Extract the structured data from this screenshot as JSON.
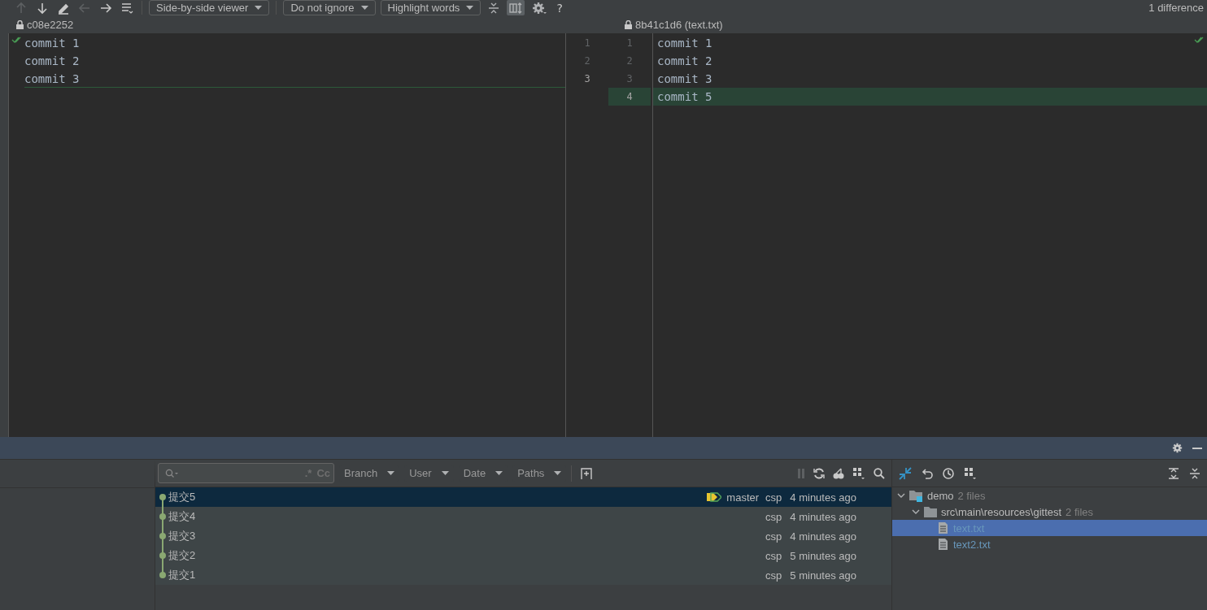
{
  "toolbar": {
    "nav_buttons": [
      {
        "kind": "up",
        "disabled": true
      },
      {
        "kind": "down",
        "disabled": false
      },
      {
        "kind": "edit",
        "disabled": false
      },
      {
        "kind": "left",
        "disabled": true
      },
      {
        "kind": "right",
        "disabled": false
      },
      {
        "kind": "list",
        "disabled": false
      }
    ],
    "dropdowns": [
      "Side-by-side viewer",
      "Do not ignore",
      "Highlight words"
    ],
    "tools": [
      {
        "kind": "collapse",
        "selected": false
      },
      {
        "kind": "sync",
        "selected": true
      },
      {
        "kind": "gear",
        "selected": false
      },
      {
        "kind": "help",
        "selected": false
      }
    ],
    "help": "?",
    "difference_count": "1 difference"
  },
  "left_pane": {
    "title": "c08e2252",
    "lines": [
      "commit 1",
      "commit 2",
      "commit 3"
    ]
  },
  "right_pane": {
    "title": "8b41c1d6 (text.txt)",
    "lines": [
      {
        "left_number": "1",
        "right_number": "1",
        "text": "commit 1",
        "kind": "same"
      },
      {
        "left_number": "2",
        "right_number": "2",
        "text": "commit 2",
        "kind": "same"
      },
      {
        "left_number": "3",
        "right_number": "3",
        "text": "commit 3",
        "kind": "same"
      },
      {
        "right_number": "4",
        "text": "commit 5",
        "kind": "added"
      }
    ]
  },
  "log": {
    "search": {
      "regex": ".*",
      "case": "Cc"
    },
    "filters": [
      "Branch",
      "User",
      "Date",
      "Paths"
    ],
    "commits": [
      {
        "subject": "提交5",
        "tag": "master",
        "author": "csp",
        "date": "4 minutes ago",
        "selected": true
      },
      {
        "subject": "提交4",
        "author": "csp",
        "date": "4 minutes ago",
        "selected": false
      },
      {
        "subject": "提交3",
        "author": "csp",
        "date": "4 minutes ago",
        "selected": false
      },
      {
        "subject": "提交2",
        "author": "csp",
        "date": "5 minutes ago",
        "selected": false
      },
      {
        "subject": "提交1",
        "author": "csp",
        "date": "5 minutes ago",
        "selected": false
      }
    ]
  },
  "changes": {
    "tree": [
      {
        "kind": "module",
        "name": "demo",
        "count": "2 files",
        "expanded": true,
        "children": [
          {
            "kind": "folder",
            "name": "src\\main\\resources\\gittest",
            "count": "2 files",
            "expanded": true,
            "children": [
              {
                "kind": "file",
                "name": "text.txt",
                "selected": true
              },
              {
                "kind": "file",
                "name": "text2.txt",
                "selected": false
              }
            ]
          }
        ]
      }
    ]
  }
}
